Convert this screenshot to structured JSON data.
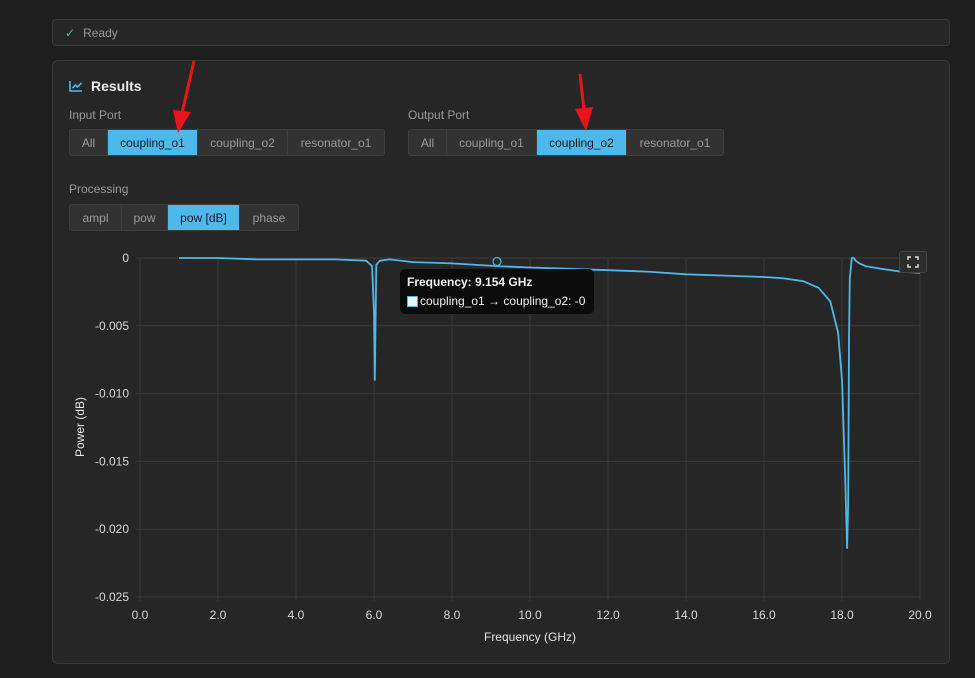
{
  "status": {
    "text": "Ready",
    "icon": "check-icon"
  },
  "results": {
    "title": "Results",
    "input_port": {
      "label": "Input Port",
      "options": [
        "All",
        "coupling_o1",
        "coupling_o2",
        "resonator_o1"
      ],
      "selected": "coupling_o1"
    },
    "output_port": {
      "label": "Output Port",
      "options": [
        "All",
        "coupling_o1",
        "coupling_o2",
        "resonator_o1"
      ],
      "selected": "coupling_o2"
    },
    "processing": {
      "label": "Processing",
      "options": [
        "ampl",
        "pow",
        "pow [dB]",
        "phase"
      ],
      "selected": "pow [dB]"
    }
  },
  "tooltip": {
    "title": "Frequency: 9.154 GHz",
    "series_label": "coupling_o1 → coupling_o2: -0"
  },
  "colors": {
    "accent": "#4fb8ea",
    "line": "#4fb8ea",
    "annotation_arrow": "#e8141c"
  },
  "chart_data": {
    "type": "line",
    "xlabel": "Frequency (GHz)",
    "ylabel": "Power (dB)",
    "xlim": [
      0,
      20
    ],
    "ylim": [
      -0.025,
      0
    ],
    "x_ticks": [
      "0.0",
      "2.0",
      "4.0",
      "6.0",
      "8.0",
      "10.0",
      "12.0",
      "14.0",
      "16.0",
      "18.0",
      "20.0"
    ],
    "y_ticks": [
      "0",
      "-0.005",
      "-0.010",
      "-0.015",
      "-0.020",
      "-0.025"
    ],
    "grid": true,
    "series": [
      {
        "x": [
          1.0,
          2.0,
          3.0,
          4.0,
          5.0,
          5.8,
          5.95,
          6.0,
          6.02,
          6.06,
          6.15,
          6.4,
          7.0,
          8.0,
          9.154,
          10.0,
          11.0,
          12.0,
          13.0,
          14.0,
          15.0,
          16.0,
          16.5,
          17.0,
          17.4,
          17.7,
          17.9,
          18.0,
          18.08,
          18.13,
          18.16,
          18.18,
          18.2,
          18.25,
          18.3,
          18.35,
          18.45,
          18.6,
          19.0,
          19.5,
          20.0
        ],
        "y": [
          0.0,
          0.0,
          -0.0001,
          -0.0001,
          -0.0001,
          -0.0002,
          -0.0006,
          -0.004,
          -0.009,
          -0.0005,
          -0.0002,
          -0.0001,
          -0.0003,
          -0.0004,
          -0.0006,
          -0.0007,
          -0.0008,
          -0.0009,
          -0.001,
          -0.0012,
          -0.0013,
          -0.0014,
          -0.0015,
          -0.0017,
          -0.0022,
          -0.0032,
          -0.0055,
          -0.009,
          -0.016,
          -0.0214,
          -0.018,
          -0.006,
          -0.0015,
          0.0,
          0.0,
          -0.0002,
          -0.0004,
          -0.0006,
          -0.0008,
          -0.001,
          -0.0011
        ]
      }
    ]
  }
}
